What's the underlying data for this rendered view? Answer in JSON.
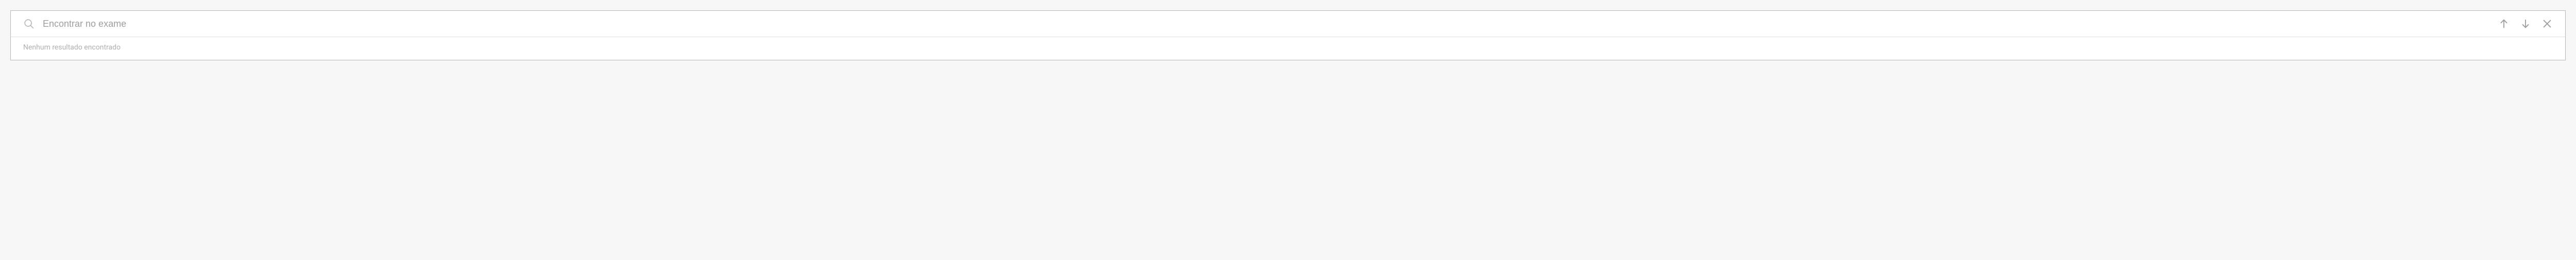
{
  "search": {
    "placeholder": "Encontrar no exame",
    "value": ""
  },
  "status": {
    "message": "Nenhum resultado encontrado"
  }
}
